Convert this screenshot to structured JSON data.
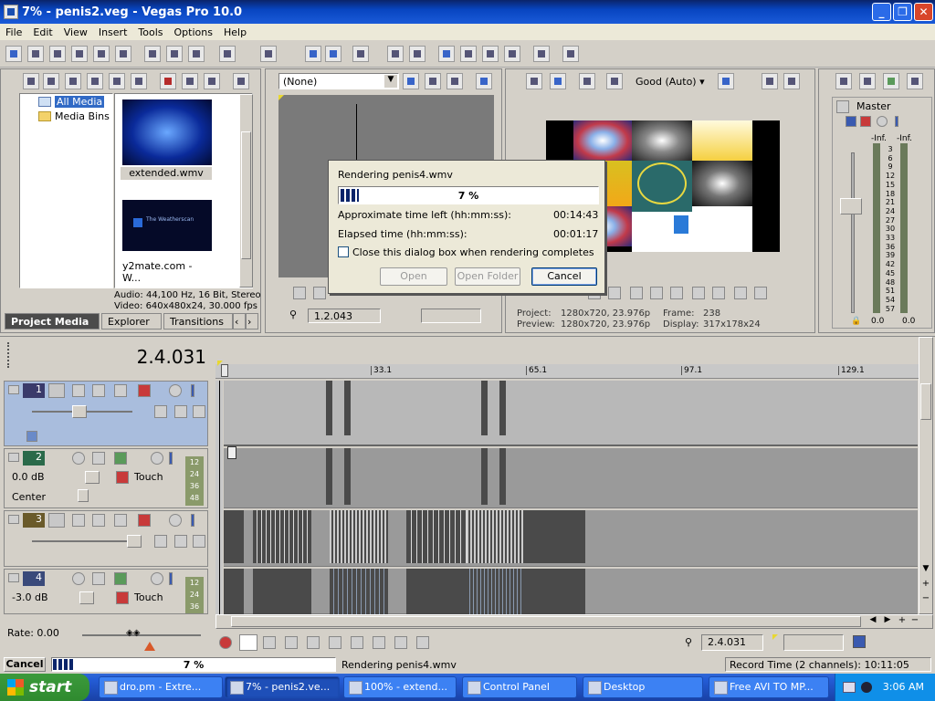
{
  "window": {
    "title": "7% - penis2.veg - Vegas Pro 10.0"
  },
  "menu": [
    "File",
    "Edit",
    "View",
    "Insert",
    "Tools",
    "Options",
    "Help"
  ],
  "media": {
    "tree": [
      "All Media",
      "Media Bins"
    ],
    "items": [
      {
        "name": "extended.wmv"
      },
      {
        "name": "y2mate.com - W..."
      }
    ],
    "thumb2_text": "The Weatherscan",
    "info_audio": "Audio: 44,100 Hz, 16 Bit, Stereo",
    "info_video": "Video: 640x480x24, 30.000 fps"
  },
  "tabs": [
    "Project Media",
    "Explorer",
    "Transitions"
  ],
  "trimmer": {
    "dropdown": "(None)",
    "time": "1.2.043"
  },
  "preview": {
    "quality": "Good (Auto)",
    "project_label": "Project:",
    "project": "1280x720, 23.976p",
    "preview_label": "Preview:",
    "preview": "1280x720, 23.976p",
    "frame_label": "Frame:",
    "frame": "238",
    "display_label": "Display:",
    "display": "317x178x24"
  },
  "master": {
    "title": "Master",
    "peak_l": "-Inf.",
    "peak_r": "-Inf.",
    "scale": [
      "3",
      "6",
      "9",
      "12",
      "15",
      "18",
      "21",
      "24",
      "27",
      "30",
      "33",
      "36",
      "39",
      "42",
      "45",
      "48",
      "51",
      "54",
      "57"
    ],
    "bottom_l": "0.0",
    "bottom_r": "0.0"
  },
  "render_dialog": {
    "title": "Rendering penis4.wmv",
    "progress_text": "7 %",
    "progress": 0.07,
    "time_left_label": "Approximate time left (hh:mm:ss):",
    "time_left": "00:14:43",
    "elapsed_label": "Elapsed time (hh:mm:ss):",
    "elapsed": "00:01:17",
    "close_checkbox": "Close this dialog box when rendering completes",
    "open": "Open",
    "open_folder": "Open Folder",
    "cancel": "Cancel"
  },
  "timeline": {
    "cursor_time": "2.4.031",
    "ruler": [
      "33.1",
      "65.1",
      "97.1",
      "129.1"
    ],
    "tracks": [
      {
        "num": "1"
      },
      {
        "num": "2",
        "db": "0.0 dB",
        "pan": "Center",
        "touch": "Touch",
        "meter": [
          "12",
          "24",
          "36",
          "48"
        ]
      },
      {
        "num": "3"
      },
      {
        "num": "4",
        "db": "-3.0 dB",
        "touch": "Touch",
        "meter": [
          "12",
          "24",
          "36"
        ]
      }
    ],
    "rate": "Rate: 0.00",
    "transport_time": "2.4.031"
  },
  "statusbar": {
    "cancel": "Cancel",
    "progress_text": "7 %",
    "progress": 0.07,
    "message": "Rendering penis4.wmv",
    "record_time": "Record Time (2 channels): 10:11:05"
  },
  "taskbar": {
    "start": "start",
    "buttons": [
      "dro.pm - Extre...",
      "7% - penis2.ve...",
      "100% - extend...",
      "Control Panel",
      "Desktop",
      "Free AVI TO MP..."
    ],
    "clock": "3:06 AM"
  },
  "colors": {
    "accent": "#0a246a",
    "progress": "#0a246a",
    "selected_track": "#a9bddd"
  }
}
